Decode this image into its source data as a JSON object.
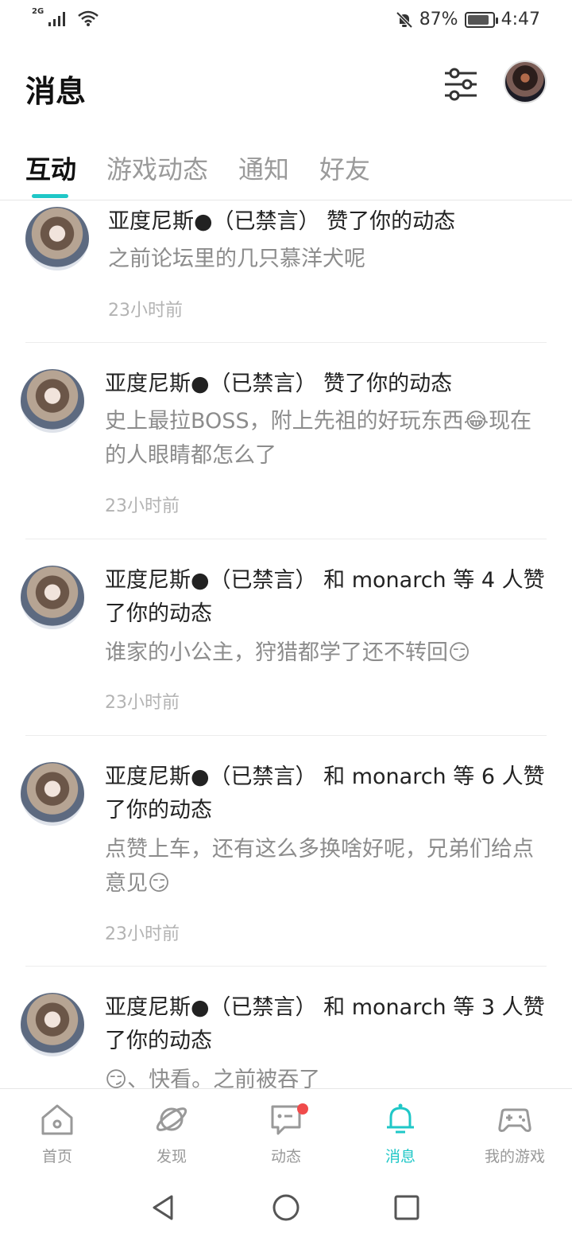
{
  "status": {
    "network": "2G",
    "battery_percent": "87%",
    "battery_level": 0.87,
    "time": "4:47"
  },
  "header": {
    "title": "消息"
  },
  "tabs": [
    {
      "label": "互动",
      "active": true
    },
    {
      "label": "游戏动态",
      "active": false
    },
    {
      "label": "通知",
      "active": false
    },
    {
      "label": "好友",
      "active": false
    }
  ],
  "messages": [
    {
      "line1": "亚度尼斯●（已禁言） 赞了你的动态",
      "body": "之前论坛里的几只慕洋犬呢",
      "time": "23小时前"
    },
    {
      "line1": "亚度尼斯●（已禁言） 赞了你的动态",
      "body": "史上最拉BOSS，附上先祖的好玩东西😂现在的人眼睛都怎么了",
      "time": "23小时前"
    },
    {
      "line1": "亚度尼斯●（已禁言） 和 monarch 等 4 人赞了你的动态",
      "body": "谁家的小公主，狩猎都学了还不转回😏",
      "time": "23小时前"
    },
    {
      "line1": "亚度尼斯●（已禁言） 和 monarch 等 6 人赞了你的动态",
      "body": "点赞上车，还有这么多换啥好呢，兄弟们给点意见😏",
      "time": "23小时前"
    },
    {
      "line1": "亚度尼斯●（已禁言） 和 monarch 等 3 人赞了你的动态",
      "body": "😏、快看。之前被吞了",
      "time": ""
    }
  ],
  "bottom_nav": [
    {
      "label": "首页",
      "icon": "home-icon",
      "active": false
    },
    {
      "label": "发现",
      "icon": "planet-icon",
      "active": false
    },
    {
      "label": "动态",
      "icon": "chat-icon",
      "active": false,
      "badge": true
    },
    {
      "label": "消息",
      "icon": "bell-icon",
      "active": true
    },
    {
      "label": "我的游戏",
      "icon": "gamepad-icon",
      "active": false
    }
  ],
  "colors": {
    "accent": "#1fc7c7",
    "badge": "#f04b4b"
  }
}
